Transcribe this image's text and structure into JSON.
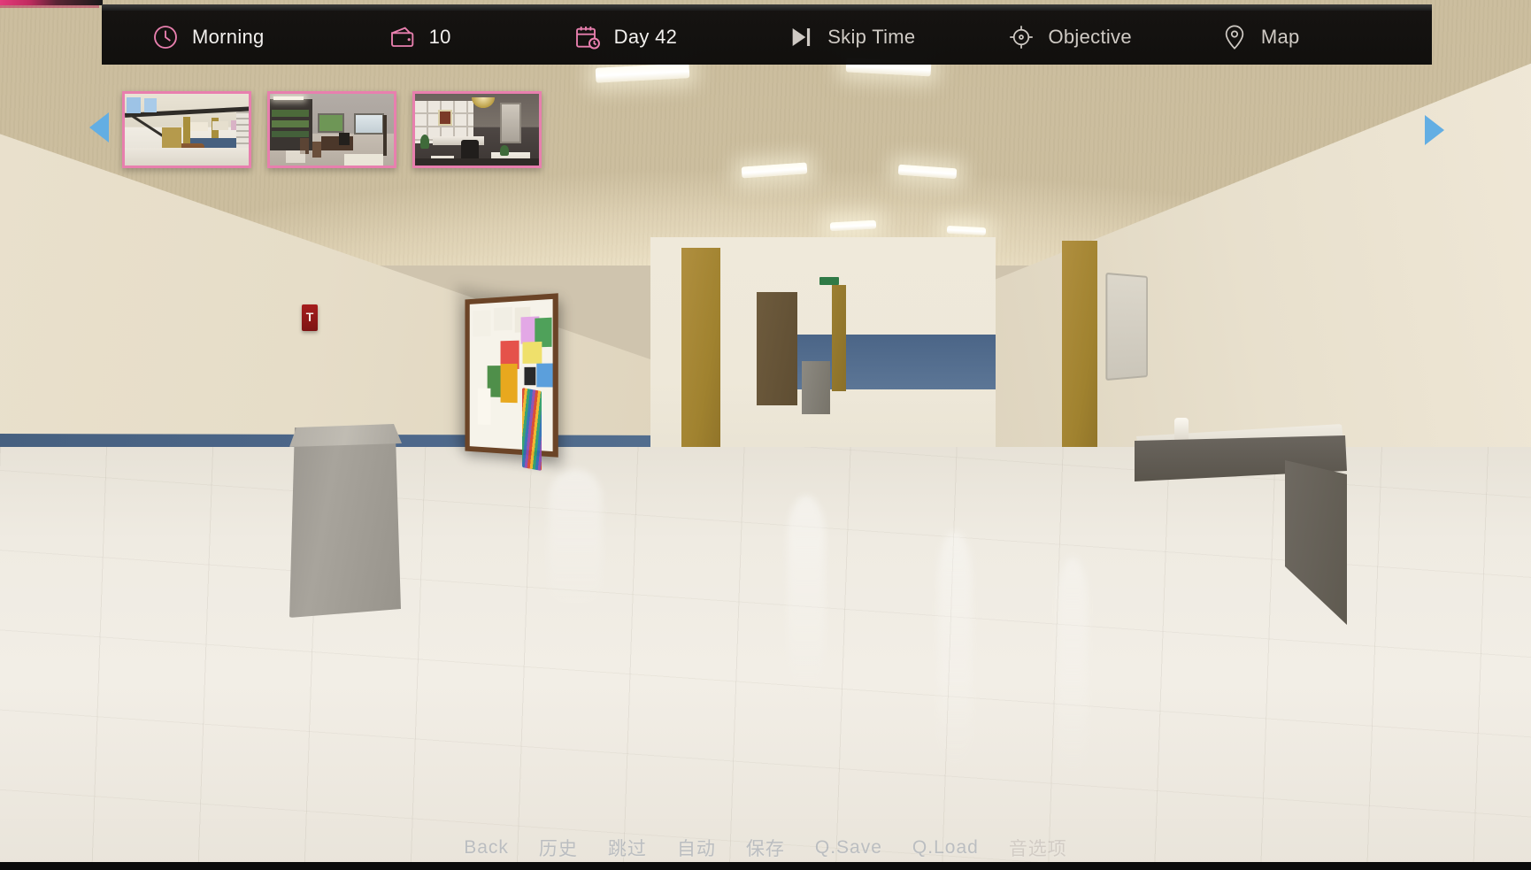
{
  "hud": {
    "time_of_day": {
      "icon": "clock-icon",
      "label": "Morning",
      "color": "#e87fae"
    },
    "money": {
      "icon": "wallet-icon",
      "label": "10",
      "color": "#e87fae"
    },
    "day": {
      "icon": "calendar-clock-icon",
      "label": "Day 42",
      "color": "#e87fae"
    },
    "skip_time": {
      "icon": "skip-forward-icon",
      "label": "Skip Time",
      "color": "#cfcac4"
    },
    "objective": {
      "icon": "crosshair-target-icon",
      "label": "Objective",
      "color": "#cfcac4"
    },
    "map": {
      "icon": "location-pin-icon",
      "label": "Map",
      "color": "#cfcac4"
    }
  },
  "location_carousel": {
    "prev_arrow": "left-triangle-arrow",
    "next_arrow": "right-triangle-arrow",
    "arrow_color": "#63aee3",
    "border_color": "#e87fae",
    "thumbnails": [
      {
        "name": "school-atrium-lobby",
        "alt": "School lobby with staircase and mezzanine"
      },
      {
        "name": "office-classroom",
        "alt": "Office room with desk, table and windows"
      },
      {
        "name": "study-library",
        "alt": "Elegant study with white bookshelves and chandelier"
      }
    ]
  },
  "scene": {
    "name": "school-hallway",
    "objects": [
      "ceiling-lights",
      "bulletin-board",
      "fire-alarm",
      "trash-can",
      "water-fountain",
      "corridor-doors"
    ],
    "wall_upper_color": "#e6ddc8",
    "wall_lower_color": "#4d678a",
    "floor_color": "#efebe2",
    "pillar_color": "#a0822f"
  },
  "bottom_menu": {
    "items": [
      {
        "name": "back",
        "label": "Back"
      },
      {
        "name": "history",
        "label": "历史"
      },
      {
        "name": "skip",
        "label": "跳过"
      },
      {
        "name": "auto",
        "label": "自动"
      },
      {
        "name": "save",
        "label": "保存"
      },
      {
        "name": "quick-save",
        "label": "Q.Save"
      },
      {
        "name": "quick-load",
        "label": "Q.Load"
      },
      {
        "name": "audio-options",
        "label": "音选项"
      }
    ]
  }
}
